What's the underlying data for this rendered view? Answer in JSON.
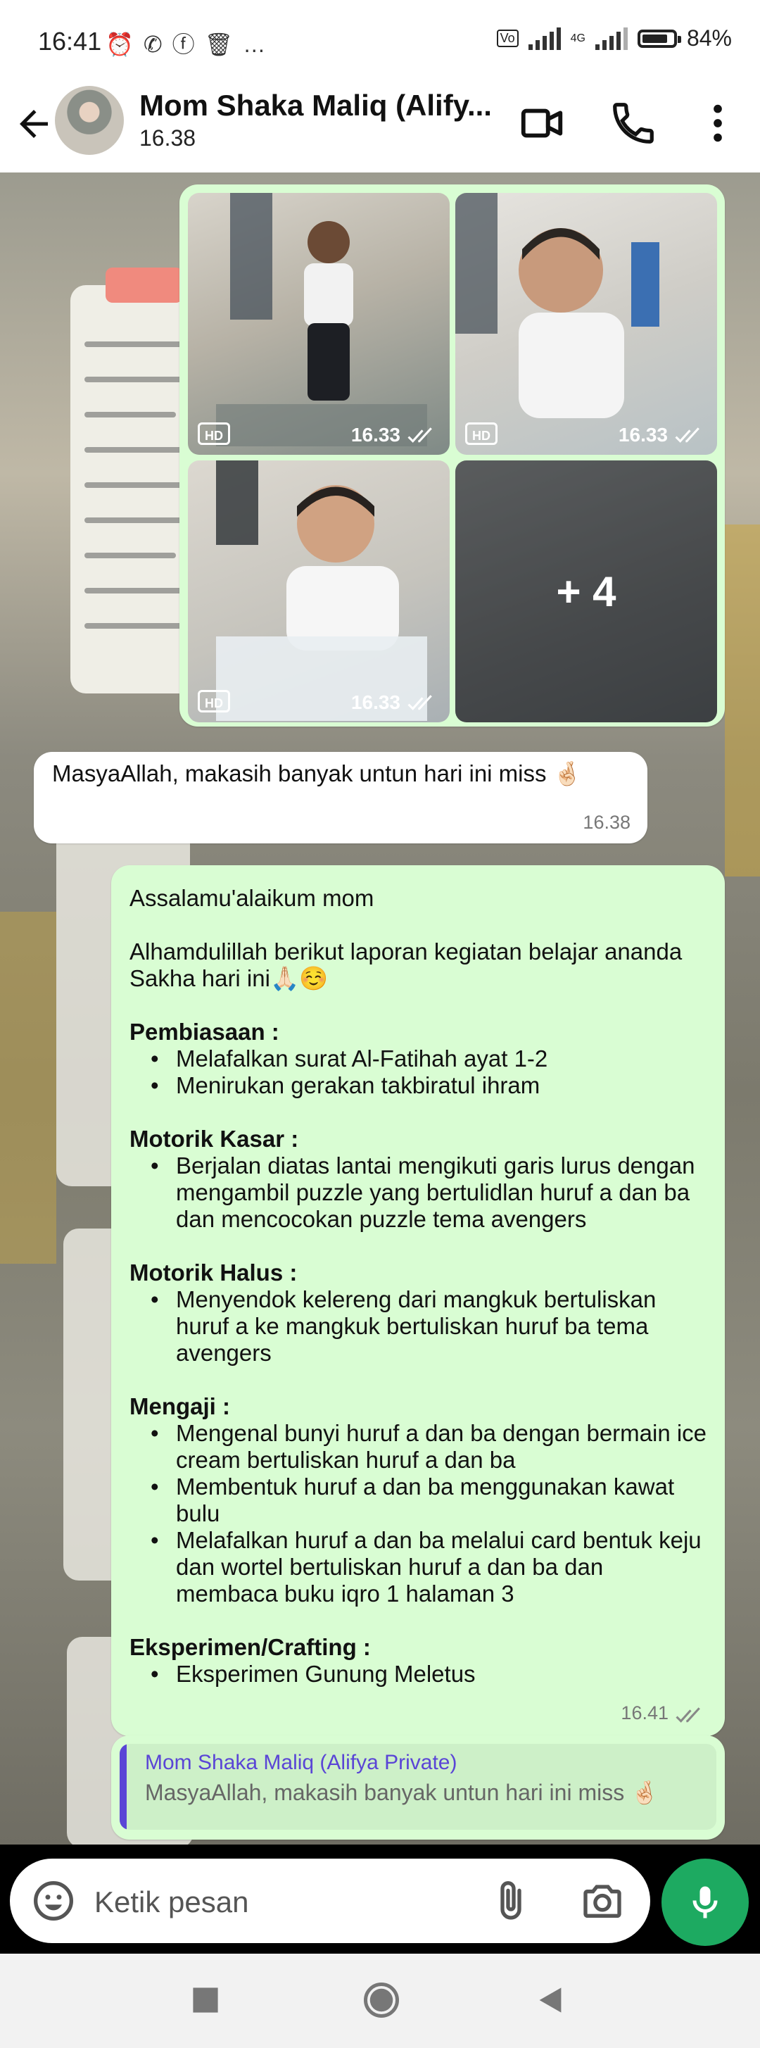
{
  "status_bar": {
    "time": "16:41",
    "icons": [
      "alarm-icon",
      "whatsapp-icon",
      "facebook-icon",
      "trash-icon",
      "more-dots-icon"
    ],
    "dots": "…",
    "network": "4G",
    "battery_percent": "84%",
    "battery_level": 0.84
  },
  "header": {
    "contact_name": "Mom Shaka Maliq (Alify...",
    "last_seen": "16.38",
    "icons": [
      "back-arrow-icon",
      "video-call-icon",
      "voice-call-icon",
      "menu-dots-icon"
    ]
  },
  "messages": {
    "photos": {
      "tiles": [
        {
          "hd": "HD",
          "time": "16.33"
        },
        {
          "hd": "HD",
          "time": "16.33"
        },
        {
          "hd": "HD",
          "time": "16.33"
        },
        {
          "more": "+ 4"
        }
      ]
    },
    "incoming": {
      "text": "MasyaAllah, makasih banyak untun hari ini miss 🤞🏻",
      "time": "16.38"
    },
    "report": {
      "greeting": "Assalamu'alaikum mom",
      "intro": "Alhamdulillah berikut laporan kegiatan belajar ananda Sakha hari ini🙏🏻☺️",
      "sections": [
        {
          "title": "Pembiasaan :",
          "items": [
            "Melafalkan surat Al-Fatihah ayat 1-2",
            "Menirukan gerakan takbiratul ihram"
          ]
        },
        {
          "title": "Motorik Kasar :",
          "items": [
            "Berjalan diatas lantai mengikuti garis lurus dengan mengambil puzzle yang bertulidlan huruf a dan ba dan mencocokan puzzle tema avengers"
          ]
        },
        {
          "title": "Motorik Halus :",
          "items": [
            "Menyendok kelereng dari mangkuk bertuliskan huruf a ke mangkuk bertuliskan huruf ba tema avengers"
          ]
        },
        {
          "title": "Mengaji :",
          "items": [
            "Mengenal bunyi huruf a dan ba dengan bermain ice cream bertuliskan huruf a dan ba",
            "Membentuk huruf a dan ba menggunakan kawat bulu",
            "Melafalkan huruf a dan ba melalui card bentuk keju dan wortel bertuliskan huruf  a dan ba dan membaca buku iqro 1 halaman 3"
          ]
        },
        {
          "title": "Eksperimen/Crafting :",
          "items": [
            "Eksperimen Gunung Meletus"
          ]
        }
      ],
      "time": "16.41"
    },
    "reply_quote": {
      "author": "Mom Shaka Maliq (Alifya Private)",
      "text": "MasyaAllah, makasih banyak untun hari ini miss 🤞🏻"
    }
  },
  "composer": {
    "placeholder": "Ketik pesan",
    "icons": [
      "emoji-icon",
      "attach-icon",
      "camera-icon",
      "mic-icon"
    ]
  },
  "nav_bar": {
    "icons": [
      "recents-icon",
      "home-icon",
      "back-icon"
    ]
  },
  "colors": {
    "outgoing_bubble": "#d9fdd3",
    "incoming_bubble": "#ffffff",
    "accent_green": "#1daa61",
    "quote_accent": "#5a45d6"
  }
}
